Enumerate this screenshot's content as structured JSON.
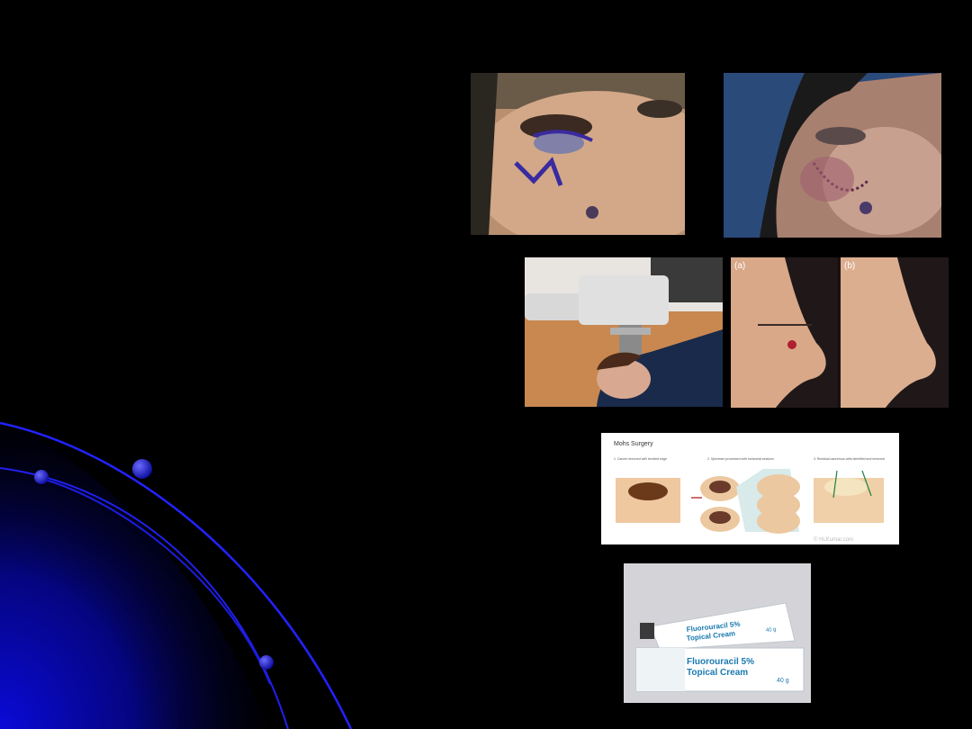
{
  "slide": {
    "background": "#000000",
    "accent": "#1a1aff"
  },
  "images": {
    "eyelid_markup": {
      "icon": "photo-eyelid-surgical-marking"
    },
    "eyelid_postop": {
      "icon": "photo-eyelid-post-operative-sutures"
    },
    "radiotherapy": {
      "icon": "photo-superficial-radiotherapy-machine"
    },
    "nose_panels": {
      "label_a": "(a)",
      "label_b": "(b)"
    },
    "mohs": {
      "title": "Mohs Surgery",
      "step1": "1. Cancer removed with beveled edge",
      "step2": "2. Specimen processed with horizontal sections",
      "step3": "3. Residual cancerous cells identified and removed",
      "watermark": "© HLKumar.com"
    },
    "cream": {
      "line1": "Fluorouracil 5%",
      "line2": "Topical Cream",
      "weight": "40 g"
    }
  }
}
